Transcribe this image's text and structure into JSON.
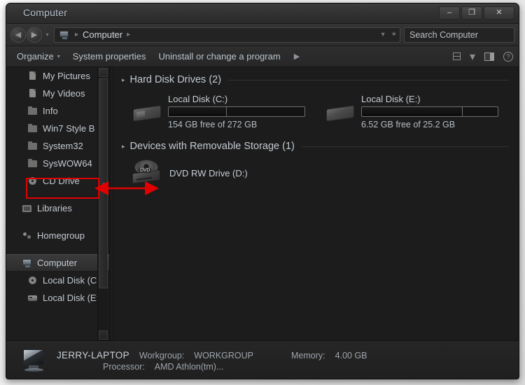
{
  "window": {
    "title": "Computer",
    "controls": {
      "minimize": "–",
      "maximize": "❐",
      "close": "✕"
    }
  },
  "address_bar": {
    "back_icon": "◀",
    "forward_icon": "▶",
    "history_icon": "▾",
    "root_icon": "computer-icon",
    "crumb": "Computer",
    "separator": "▸",
    "dropdown_icon": "▾",
    "refresh_icon": "✶"
  },
  "search": {
    "placeholder": "Search Computer",
    "value": "",
    "icon": "search-icon"
  },
  "toolbar": {
    "organize_label": "Organize",
    "organize_caret": "▾",
    "system_properties_label": "System properties",
    "uninstall_label": "Uninstall or change a program",
    "overflow_icon": "▶",
    "view_dropdown_icon": "▾",
    "icons": {
      "change_view": "change-view-icon",
      "preview_pane": "preview-pane-icon",
      "help": "?"
    }
  },
  "nav_pane": {
    "items": [
      {
        "label": "My Pictures",
        "icon": "ic-doc",
        "indent": 1,
        "selected": false
      },
      {
        "label": "My Videos",
        "icon": "ic-doc",
        "indent": 1,
        "selected": false
      },
      {
        "label": "Info",
        "icon": "ic-folder",
        "indent": 1,
        "selected": false
      },
      {
        "label": "Win7 Style B",
        "icon": "ic-folder",
        "indent": 1,
        "selected": false
      },
      {
        "label": "System32",
        "icon": "ic-folder",
        "indent": 1,
        "selected": false
      },
      {
        "label": "SysWOW64",
        "icon": "ic-folder",
        "indent": 1,
        "selected": false
      },
      {
        "label": "CD Drive",
        "icon": "ic-cd",
        "indent": 1,
        "selected": false
      },
      {
        "label": "",
        "icon": "spacer",
        "indent": 0,
        "selected": false
      },
      {
        "label": "Libraries",
        "icon": "ic-lib",
        "indent": 0,
        "selected": false
      },
      {
        "label": "",
        "icon": "spacer",
        "indent": 0,
        "selected": false
      },
      {
        "label": "Homegroup",
        "icon": "ic-home",
        "indent": 0,
        "selected": false
      },
      {
        "label": "",
        "icon": "spacer",
        "indent": 0,
        "selected": false
      },
      {
        "label": "Computer",
        "icon": "ic-comp",
        "indent": 0,
        "selected": true
      },
      {
        "label": "Local Disk (C",
        "icon": "ic-cd",
        "indent": 1,
        "selected": false
      },
      {
        "label": "Local Disk (E:",
        "icon": "ic-drive",
        "indent": 1,
        "selected": false
      }
    ]
  },
  "content": {
    "groups": [
      {
        "title": "Hard Disk Drives (2)",
        "caret": "▸",
        "drives": [
          {
            "name": "Local Disk (C:)",
            "free_text": "154 GB free of 272 GB",
            "used_percent": 43,
            "icon": "hard-disk-icon"
          },
          {
            "name": "Local Disk (E:)",
            "free_text": "6.52 GB free of 25.2 GB",
            "used_percent": 74,
            "icon": "hard-disk-icon"
          }
        ]
      },
      {
        "title": "Devices with Removable Storage (1)",
        "caret": "▸",
        "devices": [
          {
            "name": "DVD RW Drive (D:)",
            "icon": "dvd-drive-icon",
            "disc_label": "DVD"
          }
        ]
      }
    ]
  },
  "status_bar": {
    "machine_name": "JERRY-LAPTOP",
    "workgroup_label": "Workgroup:",
    "workgroup_value": "WORKGROUP",
    "memory_label": "Memory:",
    "memory_value": "4.00 GB",
    "processor_label": "Processor:",
    "processor_value": "AMD Athlon(tm)..."
  },
  "annotation": {
    "color": "#e00000",
    "type": "double-headed-arrow",
    "highlight_target": "CD Drive",
    "points_to": "DVD RW Drive (D:)"
  }
}
